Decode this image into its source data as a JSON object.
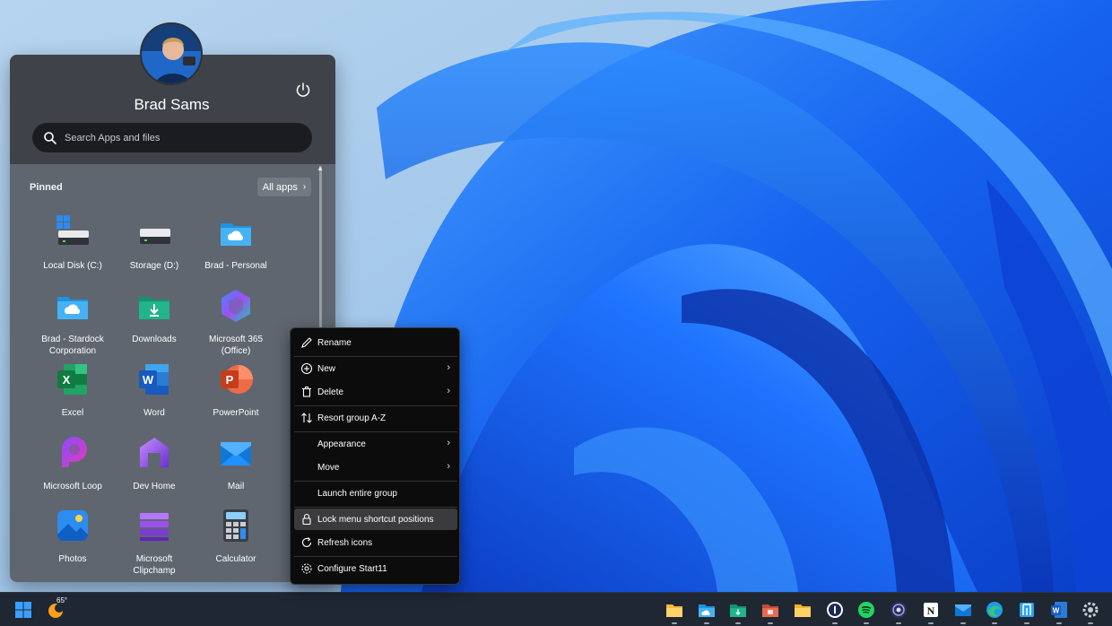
{
  "user": {
    "name": "Brad Sams"
  },
  "search": {
    "placeholder": "Search Apps and files"
  },
  "pinned": {
    "label": "Pinned",
    "all_apps_label": "All apps",
    "apps": [
      {
        "label": "Local Disk (C:)",
        "icon": "local-disk-icon"
      },
      {
        "label": "Storage (D:)",
        "icon": "storage-drive-icon"
      },
      {
        "label": "Brad - Personal",
        "icon": "onedrive-folder-icon"
      },
      {
        "label": "Brad - Stardock Corporation",
        "icon": "onedrive-folder-icon"
      },
      {
        "label": "Downloads",
        "icon": "downloads-folder-icon"
      },
      {
        "label": "Microsoft 365 (Office)",
        "icon": "microsoft-365-icon"
      },
      {
        "label": "Excel",
        "icon": "excel-icon"
      },
      {
        "label": "Word",
        "icon": "word-icon"
      },
      {
        "label": "PowerPoint",
        "icon": "powerpoint-icon"
      },
      {
        "label": "Microsoft Loop",
        "icon": "loop-icon"
      },
      {
        "label": "Dev Home",
        "icon": "dev-home-icon"
      },
      {
        "label": "Mail",
        "icon": "mail-icon"
      },
      {
        "label": "Photos",
        "icon": "photos-icon"
      },
      {
        "label": "Microsoft Clipchamp",
        "icon": "clipchamp-icon"
      },
      {
        "label": "Calculator",
        "icon": "calculator-icon"
      }
    ]
  },
  "context_menu": {
    "items": [
      {
        "label": "Rename",
        "icon": "pencil-icon",
        "submenu": false
      },
      {
        "label": "New",
        "icon": "plus-circle-icon",
        "submenu": true
      },
      {
        "label": "Delete",
        "icon": "trash-icon",
        "submenu": true
      },
      {
        "label": "Resort group A-Z",
        "icon": "sort-icon",
        "submenu": false
      },
      {
        "label": "Appearance",
        "icon": "",
        "submenu": true
      },
      {
        "label": "Move",
        "icon": "",
        "submenu": true
      },
      {
        "label": "Launch entire group",
        "icon": "",
        "submenu": false
      },
      {
        "label": "Lock menu shortcut positions",
        "icon": "lock-icon",
        "submenu": false,
        "highlighted": true
      },
      {
        "label": "Refresh icons",
        "icon": "refresh-icon",
        "submenu": false
      },
      {
        "label": "Configure Start11",
        "icon": "gear-icon",
        "submenu": false
      }
    ]
  },
  "taskbar": {
    "weather_temp": "65°",
    "icons": [
      "file-explorer-icon",
      "onedrive-folder-icon",
      "downloads-folder-icon",
      "folder-photos-icon",
      "folder-icon",
      "1password-icon",
      "spotify-icon",
      "obs-icon",
      "notion-icon",
      "mail-icon",
      "edge-icon",
      "to-do-icon",
      "word-icon",
      "settings-icon"
    ]
  },
  "colors": {
    "wallpaper_blue": "#1a63f0",
    "menu_bg": "#5f6670",
    "context_bg": "#0c0c0d",
    "taskbar_bg": "#1f2733"
  }
}
